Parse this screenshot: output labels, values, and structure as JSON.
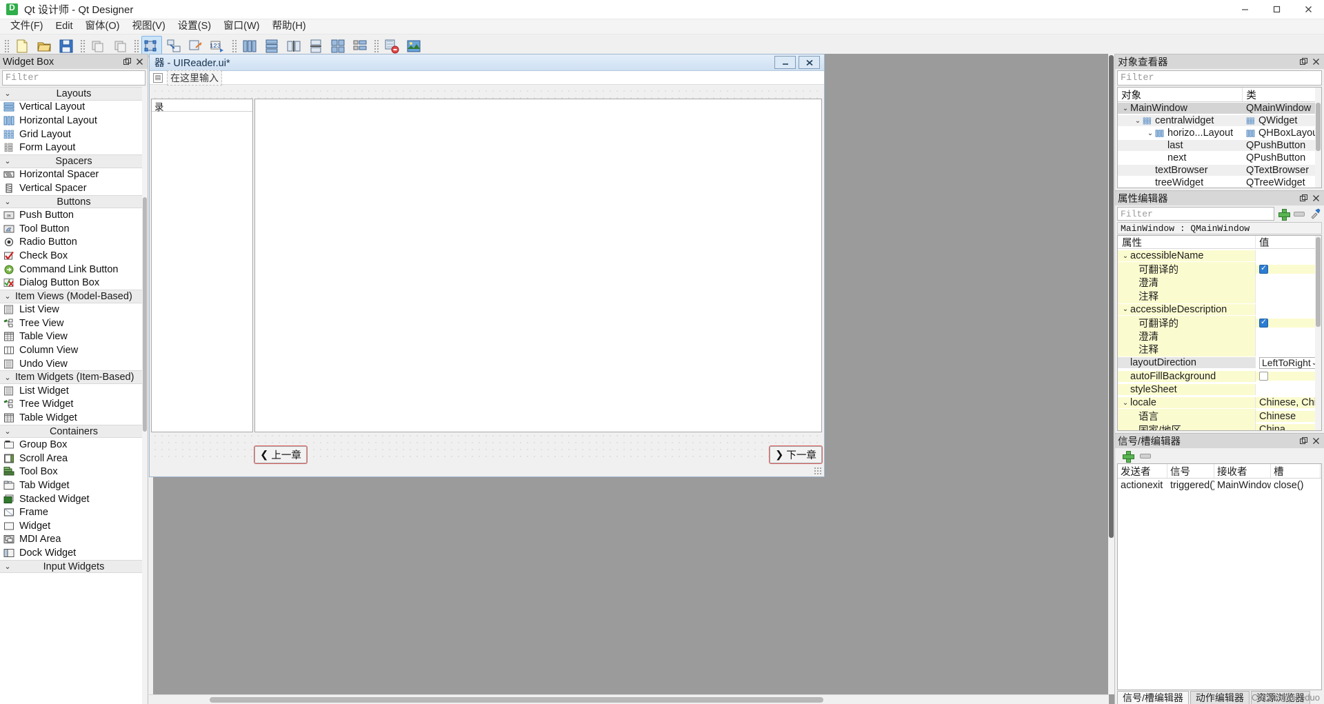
{
  "window": {
    "title": "Qt 设计师 - Qt Designer",
    "app_icon": "designer-icon",
    "minimize": "minimize-icon",
    "maximize": "maximize-icon",
    "close": "close-icon"
  },
  "menubar": {
    "items": [
      {
        "label": "文件(F)"
      },
      {
        "label": "Edit"
      },
      {
        "label": "窗体(O)"
      },
      {
        "label": "视图(V)"
      },
      {
        "label": "设置(S)"
      },
      {
        "label": "窗口(W)"
      },
      {
        "label": "帮助(H)"
      }
    ]
  },
  "toolbar": {
    "buttons": [
      {
        "name": "new-form-icon"
      },
      {
        "name": "open-form-icon"
      },
      {
        "name": "save-form-icon"
      },
      {
        "name": "undo-icon"
      },
      {
        "name": "redo-icon"
      },
      {
        "name": "edit-widgets-icon",
        "active": true
      },
      {
        "name": "edit-signals-slots-icon"
      },
      {
        "name": "edit-buddies-icon"
      },
      {
        "name": "edit-tab-order-icon"
      },
      {
        "name": "layout-horizontally-icon"
      },
      {
        "name": "layout-vertically-icon"
      },
      {
        "name": "layout-splitter-horizontal-icon"
      },
      {
        "name": "layout-splitter-vertical-icon"
      },
      {
        "name": "layout-grid-icon"
      },
      {
        "name": "layout-form-icon"
      },
      {
        "name": "break-layout-icon"
      },
      {
        "name": "adjust-size-icon"
      }
    ]
  },
  "widget_box": {
    "title": "Widget Box",
    "float_btn": "float-icon",
    "close_btn": "close-icon",
    "filter_placeholder": "Filter",
    "groups": [
      {
        "label": "Layouts",
        "align": "center",
        "items": [
          {
            "label": "Vertical Layout",
            "icon": "vertical-layout-icon"
          },
          {
            "label": "Horizontal Layout",
            "icon": "horizontal-layout-icon"
          },
          {
            "label": "Grid Layout",
            "icon": "grid-layout-icon"
          },
          {
            "label": "Form Layout",
            "icon": "form-layout-icon"
          }
        ]
      },
      {
        "label": "Spacers",
        "align": "center",
        "items": [
          {
            "label": "Horizontal Spacer",
            "icon": "horizontal-spacer-icon"
          },
          {
            "label": "Vertical Spacer",
            "icon": "vertical-spacer-icon"
          }
        ]
      },
      {
        "label": "Buttons",
        "align": "center",
        "items": [
          {
            "label": "Push Button",
            "icon": "push-button-icon"
          },
          {
            "label": "Tool Button",
            "icon": "tool-button-icon"
          },
          {
            "label": "Radio Button",
            "icon": "radio-button-icon"
          },
          {
            "label": "Check Box",
            "icon": "check-box-icon"
          },
          {
            "label": "Command Link Button",
            "icon": "command-link-button-icon"
          },
          {
            "label": "Dialog Button Box",
            "icon": "dialog-button-box-icon"
          }
        ]
      },
      {
        "label": "Item Views (Model-Based)",
        "align": "left",
        "items": [
          {
            "label": "List View",
            "icon": "list-view-icon"
          },
          {
            "label": "Tree View",
            "icon": "tree-view-icon"
          },
          {
            "label": "Table View",
            "icon": "table-view-icon"
          },
          {
            "label": "Column View",
            "icon": "column-view-icon"
          },
          {
            "label": "Undo View",
            "icon": "undo-view-icon"
          }
        ]
      },
      {
        "label": "Item Widgets (Item-Based)",
        "align": "left",
        "items": [
          {
            "label": "List Widget",
            "icon": "list-widget-icon"
          },
          {
            "label": "Tree Widget",
            "icon": "tree-widget-icon"
          },
          {
            "label": "Table Widget",
            "icon": "table-widget-icon"
          }
        ]
      },
      {
        "label": "Containers",
        "align": "center",
        "items": [
          {
            "label": "Group Box",
            "icon": "group-box-icon"
          },
          {
            "label": "Scroll Area",
            "icon": "scroll-area-icon"
          },
          {
            "label": "Tool Box",
            "icon": "tool-box-icon"
          },
          {
            "label": "Tab Widget",
            "icon": "tab-widget-icon"
          },
          {
            "label": "Stacked Widget",
            "icon": "stacked-widget-icon"
          },
          {
            "label": "Frame",
            "icon": "frame-icon"
          },
          {
            "label": "Widget",
            "icon": "widget-icon"
          },
          {
            "label": "MDI Area",
            "icon": "mdi-area-icon"
          },
          {
            "label": "Dock Widget",
            "icon": "dock-widget-icon"
          }
        ]
      },
      {
        "label": "Input Widgets",
        "align": "center",
        "items": []
      }
    ]
  },
  "form": {
    "title": "器 - UIReader.ui*",
    "menu_placeholder": "在这里输入",
    "menu_icon": "type-here-icon",
    "minimize": "minimize-icon",
    "close": "close-icon",
    "tree_header": "录",
    "prev_button": "上一章",
    "next_button": "下一章",
    "prev_icon": "chevron-left-icon",
    "next_icon": "chevron-right-icon"
  },
  "object_inspector": {
    "title": "对象查看器",
    "float_btn": "float-icon",
    "close_btn": "close-icon",
    "filter_placeholder": "Filter",
    "columns": [
      "对象",
      "类"
    ],
    "rows": [
      {
        "name": "MainWindow",
        "class": "QMainWindow",
        "depth": 0,
        "expandable": true,
        "icon": "",
        "selected": true
      },
      {
        "name": "centralwidget",
        "class": "QWidget",
        "depth": 1,
        "expandable": true,
        "icon": "grid-layout-icon",
        "selected": false
      },
      {
        "name": "horizo...Layout",
        "class": "QHBoxLayout",
        "depth": 2,
        "expandable": true,
        "icon": "horizontal-layout-icon",
        "selected": false
      },
      {
        "name": "last",
        "class": "QPushButton",
        "depth": 3,
        "expandable": false,
        "icon": "",
        "selected": false
      },
      {
        "name": "next",
        "class": "QPushButton",
        "depth": 3,
        "expandable": false,
        "icon": "",
        "selected": false
      },
      {
        "name": "textBrowser",
        "class": "QTextBrowser",
        "depth": 2,
        "expandable": false,
        "icon": "",
        "selected": false
      },
      {
        "name": "treeWidget",
        "class": "QTreeWidget",
        "depth": 2,
        "expandable": false,
        "icon": "",
        "selected": false
      }
    ]
  },
  "property_editor": {
    "title": "属性编辑器",
    "float_btn": "float-icon",
    "close_btn": "close-icon",
    "filter_placeholder": "Filter",
    "add_btn": "add-icon",
    "remove_btn": "remove-icon",
    "config_btn": "configure-icon",
    "object_class": "MainWindow : QMainWindow",
    "columns": [
      "属性",
      "值"
    ],
    "rows": [
      {
        "key": "accessibleName",
        "value": "",
        "depth": 0,
        "expandable": true,
        "style": "yellow",
        "type": "text"
      },
      {
        "key": "可翻译的",
        "value": "",
        "depth": 1,
        "expandable": false,
        "style": "yellow",
        "type": "checkbox-checked"
      },
      {
        "key": "澄清",
        "value": "",
        "depth": 1,
        "expandable": false,
        "style": "yellow",
        "type": "text"
      },
      {
        "key": "注释",
        "value": "",
        "depth": 1,
        "expandable": false,
        "style": "yellow",
        "type": "text"
      },
      {
        "key": "accessibleDescription",
        "value": "",
        "depth": 0,
        "expandable": true,
        "style": "yellow",
        "type": "text"
      },
      {
        "key": "可翻译的",
        "value": "",
        "depth": 1,
        "expandable": false,
        "style": "yellow",
        "type": "checkbox-checked"
      },
      {
        "key": "澄清",
        "value": "",
        "depth": 1,
        "expandable": false,
        "style": "yellow",
        "type": "text"
      },
      {
        "key": "注释",
        "value": "",
        "depth": 1,
        "expandable": false,
        "style": "yellow",
        "type": "text"
      },
      {
        "key": "layoutDirection",
        "value": "LeftToRight",
        "depth": 0,
        "expandable": false,
        "style": "gray",
        "type": "combo"
      },
      {
        "key": "autoFillBackground",
        "value": "",
        "depth": 0,
        "expandable": false,
        "style": "yellow",
        "type": "checkbox-empty"
      },
      {
        "key": "styleSheet",
        "value": "",
        "depth": 0,
        "expandable": false,
        "style": "yellow",
        "type": "text"
      },
      {
        "key": "locale",
        "value": "Chinese, China",
        "depth": 0,
        "expandable": true,
        "style": "yellow",
        "type": "text"
      },
      {
        "key": "语言",
        "value": "Chinese",
        "depth": 1,
        "expandable": false,
        "style": "yellow",
        "type": "text"
      },
      {
        "key": "国家/地区",
        "value": "China",
        "depth": 1,
        "expandable": false,
        "style": "yellow",
        "type": "text"
      }
    ]
  },
  "signal_editor": {
    "title": "信号/槽编辑器",
    "float_btn": "float-icon",
    "close_btn": "close-icon",
    "add_btn": "add-icon",
    "remove_btn": "remove-icon",
    "columns": [
      "发送者",
      "信号",
      "接收者",
      "槽"
    ],
    "rows": [
      {
        "sender": "actionexit",
        "signal": "triggered()",
        "receiver": "MainWindow",
        "slot": "close()"
      }
    ]
  },
  "bottom_tabs": {
    "tabs": [
      {
        "label": "信号/槽编辑器",
        "selected": true
      },
      {
        "label": "动作编辑器",
        "selected": false
      },
      {
        "label": "资源浏览器",
        "selected": false
      }
    ]
  },
  "watermark": "CSDN @pikeduo"
}
